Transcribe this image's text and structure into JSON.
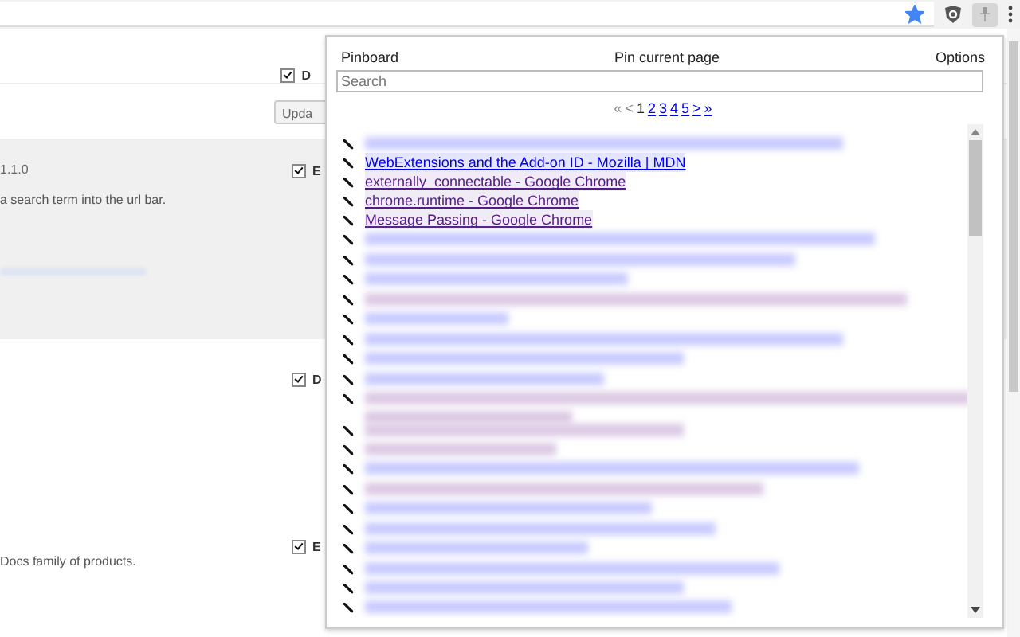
{
  "toolbar": {
    "bookmarked": true,
    "extension_active": true
  },
  "page": {
    "developer_mode": {
      "label": "D",
      "checked": true
    },
    "update_button": "Upda",
    "extensions": [
      {
        "version": "1.1.0",
        "description": "a search term into the url bar.",
        "redacted": true,
        "enabled_label": "E",
        "checked": true,
        "highlighted": true
      },
      {
        "enabled_label": "D",
        "checked": true,
        "highlighted": false
      },
      {
        "description": "Docs family of products.",
        "enabled_label": "E",
        "checked": true,
        "highlighted": false
      }
    ]
  },
  "popup": {
    "title": "Pinboard",
    "pin_link": "Pin current page",
    "options_link": "Options",
    "search": {
      "placeholder": "Search"
    },
    "pagination": [
      {
        "label": "«",
        "kind": "disabled"
      },
      {
        "label": "<",
        "kind": "disabled"
      },
      {
        "label": "1",
        "kind": "current"
      },
      {
        "label": "2",
        "kind": "link"
      },
      {
        "label": "3",
        "kind": "link"
      },
      {
        "label": "4",
        "kind": "link"
      },
      {
        "label": "5",
        "kind": "link"
      },
      {
        "label": ">",
        "kind": "link"
      },
      {
        "label": "»",
        "kind": "link"
      }
    ],
    "bookmarks": [
      {
        "kind": "blurred",
        "visited": false
      },
      {
        "kind": "link",
        "title": "WebExtensions and the Add-on ID - Mozilla | MDN",
        "visited": false
      },
      {
        "kind": "link",
        "title": "externally_connectable - Google Chrome",
        "visited": true
      },
      {
        "kind": "link",
        "title": "chrome.runtime - Google Chrome",
        "visited": true
      },
      {
        "kind": "link",
        "title": "Message Passing - Google Chrome",
        "visited": true
      },
      {
        "kind": "blurred",
        "visited": false
      },
      {
        "kind": "blurred",
        "visited": false
      },
      {
        "kind": "blurred",
        "visited": false
      },
      {
        "kind": "blurred",
        "visited": true
      },
      {
        "kind": "blurred",
        "visited": false
      },
      {
        "kind": "blurred",
        "visited": false
      },
      {
        "kind": "blurred",
        "visited": false
      },
      {
        "kind": "blurred",
        "visited": false
      },
      {
        "kind": "blurred_long",
        "visited": true
      },
      {
        "kind": "blurred",
        "visited": true
      },
      {
        "kind": "blurred",
        "visited": true
      },
      {
        "kind": "blurred",
        "visited": false
      },
      {
        "kind": "blurred",
        "visited": true
      },
      {
        "kind": "blurred",
        "visited": false
      },
      {
        "kind": "blurred",
        "visited": false
      },
      {
        "kind": "blurred",
        "visited": false
      },
      {
        "kind": "blurred",
        "visited": false
      },
      {
        "kind": "blurred",
        "visited": false
      },
      {
        "kind": "blurred",
        "visited": false
      }
    ]
  }
}
